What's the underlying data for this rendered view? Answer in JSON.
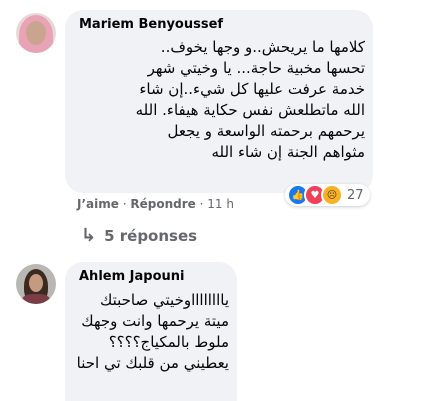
{
  "comment1": {
    "author": "Mariem Benyoussef",
    "text": "كلامها ما يريحش..و وجها يخوف..\nتحسها مخبية حاجة... يا وخيتي شهر\nخدمة عرفت عليها كل شيء..إن شاء\nالله ماتطلعش نفس حكاية هيفاء. الله\nيرحمهم برحمته الواسعة و يجعل\nمثواهم الجنة إن شاء الله",
    "reactions": {
      "count": "27",
      "icons": [
        "like-icon",
        "love-icon",
        "sad-icon"
      ]
    },
    "actions": {
      "like": "J’aime",
      "sep1": "·",
      "reply": "Répondre",
      "sep2": "·",
      "time": "11 h"
    },
    "replies_link": "5 réponses"
  },
  "comment2": {
    "author": "Ahlem Japouni",
    "text": "يااااااااوخيتي صاحبتك\nميتة يرحمها وانت وجهك\nملوط بالمكياج؟؟؟؟\nيعطيني من قلبك تي احنا"
  },
  "colors": {
    "bubble": "#f0f2f5",
    "meta_text": "#65676b",
    "like": "#1877f2",
    "love": "#f33e58",
    "sad": "#f7b125"
  }
}
